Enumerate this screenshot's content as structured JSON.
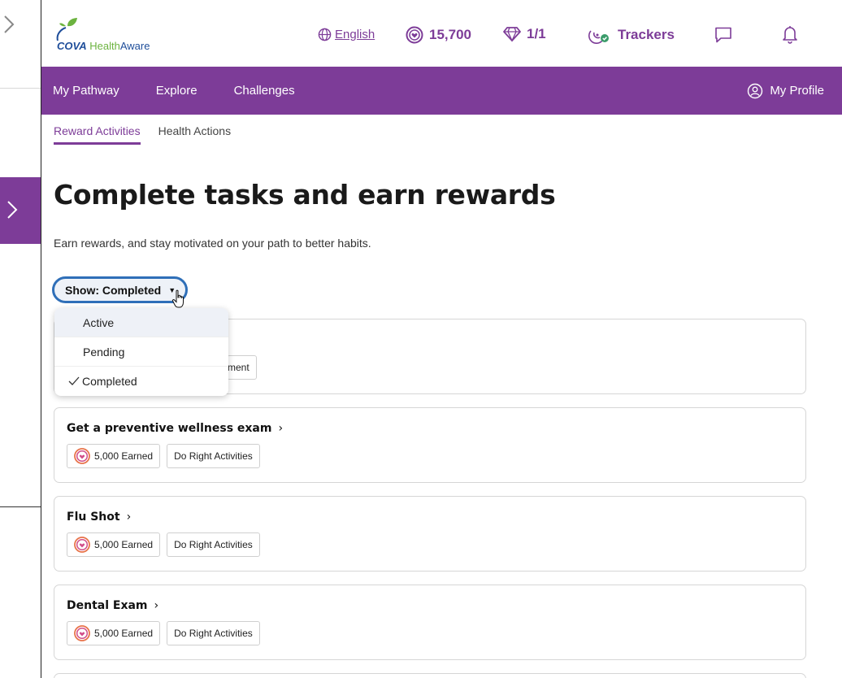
{
  "brand": {
    "cova": "COVA",
    "health": "Health",
    "aware": "Aware"
  },
  "header": {
    "language": "English",
    "points": "15,700",
    "gems": "1/1",
    "trackers": "Trackers"
  },
  "nav": {
    "items": [
      {
        "label": "My Pathway"
      },
      {
        "label": "Explore"
      },
      {
        "label": "Challenges"
      }
    ],
    "profile": "My Profile"
  },
  "subtabs": [
    {
      "label": "Reward Activities",
      "active": true
    },
    {
      "label": "Health Actions",
      "active": false
    }
  ],
  "page": {
    "title": "Complete tasks and earn rewards",
    "subtitle": "Earn rewards, and stay motivated on your path to better habits."
  },
  "filter": {
    "label": "Show: Completed",
    "options": [
      {
        "label": "Active",
        "state": "hover"
      },
      {
        "label": "Pending",
        "state": ""
      },
      {
        "label": "Completed",
        "state": "selected"
      }
    ]
  },
  "partial_card": {
    "tag_fragment": "ment"
  },
  "cards": [
    {
      "title": "Get a preventive wellness exam",
      "earned": "5,000 Earned",
      "category": "Do Right Activities"
    },
    {
      "title": "Flu Shot",
      "earned": "5,000 Earned",
      "category": "Do Right Activities"
    },
    {
      "title": "Dental Exam",
      "earned": "5,000 Earned",
      "category": "Do Right Activities"
    }
  ],
  "colors": {
    "purple": "#7d3c98",
    "focus_blue": "#2f6fb8",
    "logo_blue": "#1f4e9a",
    "logo_green": "#6cb33f",
    "points_ring": "#e8734a"
  },
  "icons": [
    "globe-icon",
    "points-icon",
    "diamond-icon",
    "trackers-icon",
    "chat-icon",
    "bell-icon",
    "profile-icon",
    "chevron-right-icon",
    "check-icon",
    "caret-down-icon",
    "hand-cursor-icon"
  ]
}
